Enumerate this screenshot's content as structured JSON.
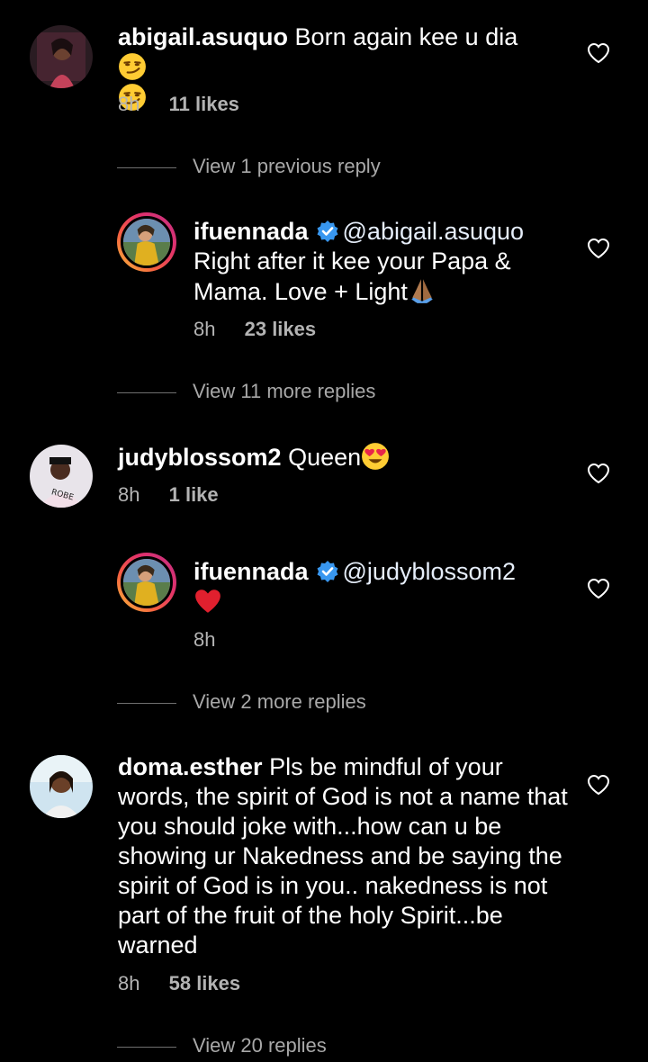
{
  "comments": [
    {
      "username": "abigail.asuquo",
      "text": "Born again kee u dia",
      "time": "8h",
      "likes": "11 likes",
      "view_replies": "View 1 previous reply"
    },
    {
      "username": "ifuennada",
      "mention": "@abigail.asuquo",
      "text": "Right after it kee your Papa & Mama. Love + Light",
      "time": "8h",
      "likes": "23 likes",
      "view_replies": "View 11 more replies"
    },
    {
      "username": "judyblossom2",
      "text": "Queen",
      "time": "8h",
      "likes": "1 like"
    },
    {
      "username": "ifuennada",
      "mention": "@judyblossom2",
      "text": "",
      "time": "8h",
      "view_replies": "View 2 more replies"
    },
    {
      "username": "doma.esther",
      "text": "Pls be mindful of your words, the spirit of God is not a name that you should joke with...how can u be showing ur Nakedness and be saying the spirit of God is in you.. nakedness is not part of the fruit of the holy Spirit...be warned",
      "time": "8h",
      "likes": "58 likes",
      "view_replies": "View 20 replies"
    }
  ],
  "colors": {
    "background": "#000000",
    "verified": "#3897f0",
    "heart_red": "#e0202e"
  }
}
